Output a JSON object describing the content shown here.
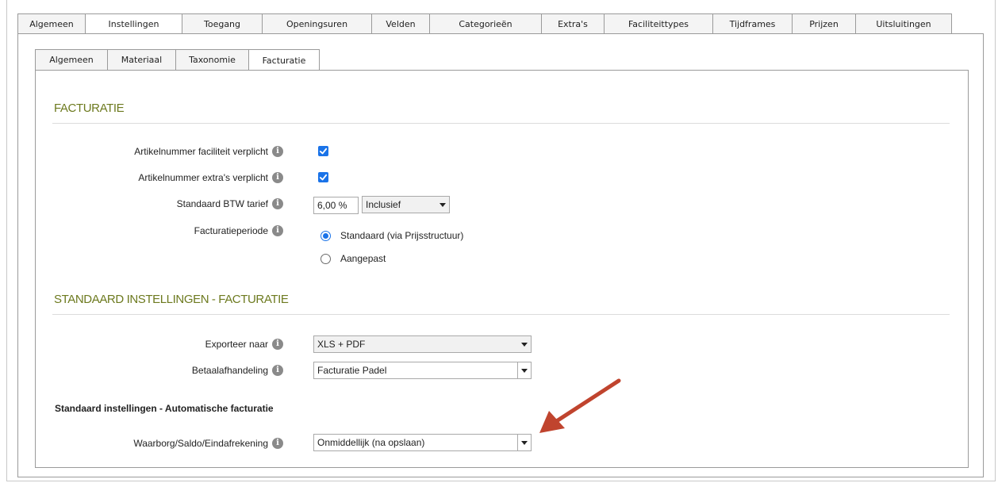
{
  "top_tabs": [
    {
      "label": "Algemeen",
      "active": false
    },
    {
      "label": "Instellingen",
      "active": true
    },
    {
      "label": "Toegang",
      "active": false
    },
    {
      "label": "Openingsuren",
      "active": false
    },
    {
      "label": "Velden",
      "active": false
    },
    {
      "label": "Categorieën",
      "active": false
    },
    {
      "label": "Extra's",
      "active": false
    },
    {
      "label": "Faciliteittypes",
      "active": false
    },
    {
      "label": "Tijdframes",
      "active": false
    },
    {
      "label": "Prijzen",
      "active": false
    },
    {
      "label": "Uitsluitingen",
      "active": false
    }
  ],
  "sub_tabs": [
    {
      "label": "Algemeen",
      "active": false
    },
    {
      "label": "Materiaal",
      "active": false
    },
    {
      "label": "Taxonomie",
      "active": false
    },
    {
      "label": "Facturatie",
      "active": true
    }
  ],
  "section1": {
    "title": "FACTURATIE",
    "article_facility": {
      "label": "Artikelnummer faciliteit verplicht",
      "checked": true
    },
    "article_extras": {
      "label": "Artikelnummer extra's verplicht",
      "checked": true
    },
    "vat": {
      "label": "Standaard BTW tarief",
      "value": "6,00 %",
      "mode": "Inclusief"
    },
    "period": {
      "label": "Facturatieperiode",
      "options": [
        {
          "label": "Standaard (via Prijsstructuur)",
          "checked": true
        },
        {
          "label": "Aangepast",
          "checked": false
        }
      ]
    }
  },
  "section2": {
    "title": "STANDAARD INSTELLINGEN - FACTURATIE",
    "export": {
      "label": "Exporteer naar",
      "value": "XLS + PDF"
    },
    "payment": {
      "label": "Betaalafhandeling",
      "value": "Facturatie Padel"
    },
    "subheading": "Standaard instellingen - Automatische facturatie",
    "deposit": {
      "label": "Waarborg/Saldo/Eindafrekening",
      "value": "Onmiddellijk (na opslaan)"
    }
  },
  "colors": {
    "accent_green": "#6d7a1f",
    "check_blue": "#1a73e8",
    "arrow_red": "#c0442e"
  }
}
